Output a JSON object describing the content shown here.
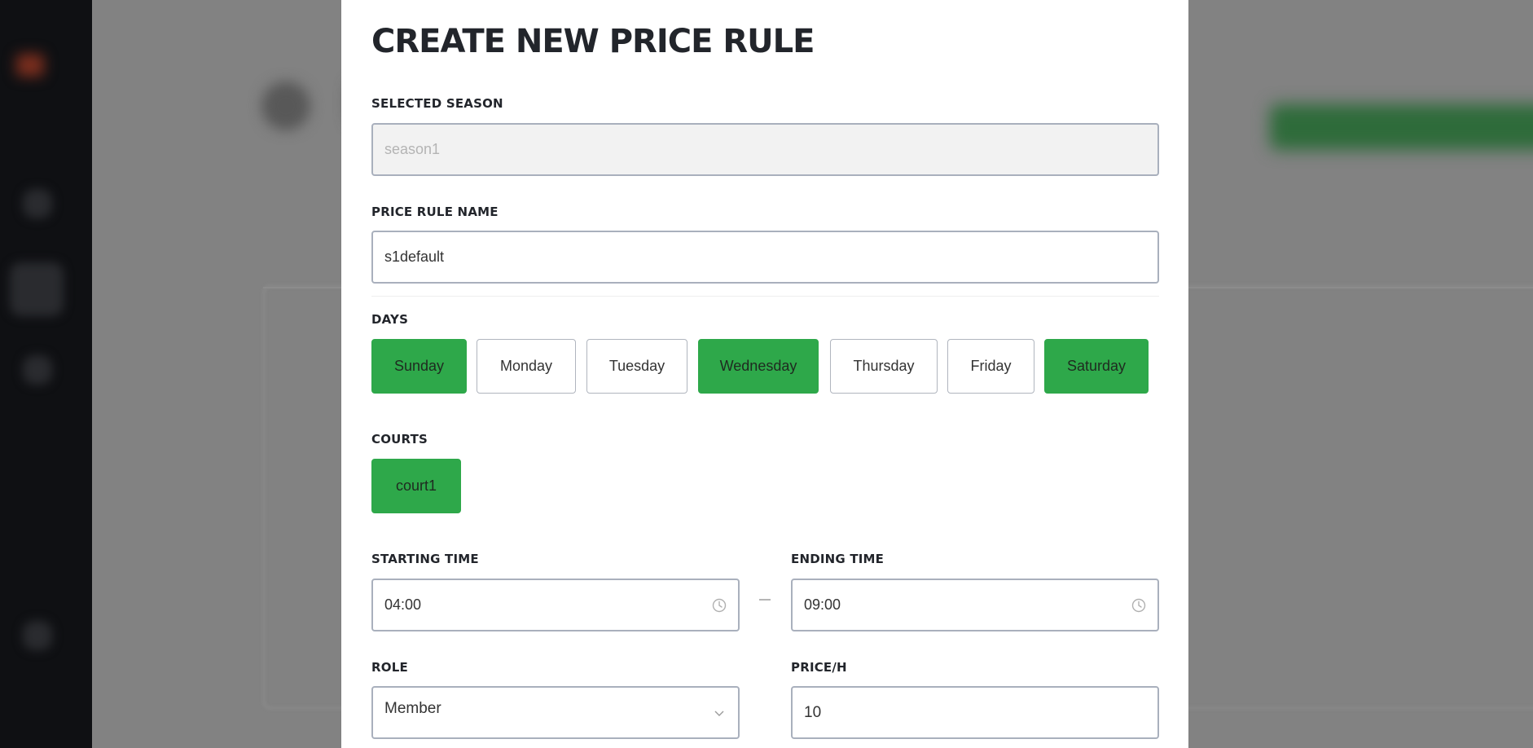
{
  "modal": {
    "title": "CREATE NEW PRICE RULE",
    "season": {
      "label": "SELECTED SEASON",
      "value": "season1"
    },
    "rule_name": {
      "label": "PRICE RULE NAME",
      "value": "s1default"
    },
    "days": {
      "label": "DAYS",
      "items": [
        {
          "label": "Sunday",
          "selected": true
        },
        {
          "label": "Monday",
          "selected": false
        },
        {
          "label": "Tuesday",
          "selected": false
        },
        {
          "label": "Wednesday",
          "selected": true
        },
        {
          "label": "Thursday",
          "selected": false
        },
        {
          "label": "Friday",
          "selected": false
        },
        {
          "label": "Saturday",
          "selected": true
        }
      ]
    },
    "courts": {
      "label": "COURTS",
      "items": [
        {
          "label": "court1",
          "selected": true
        }
      ]
    },
    "starting_time": {
      "label": "STARTING TIME",
      "value": "04:00"
    },
    "ending_time": {
      "label": "ENDING TIME",
      "value": "09:00"
    },
    "role": {
      "label": "ROLE",
      "value": "Member"
    },
    "price": {
      "label": "PRICE/H",
      "value": "10"
    }
  },
  "colors": {
    "selected": "#2ea84a",
    "border": "#a9b0bd"
  }
}
